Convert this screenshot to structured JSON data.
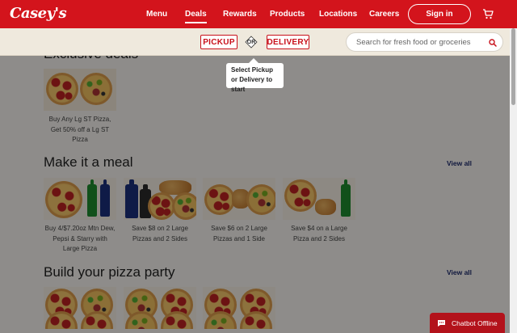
{
  "brand": {
    "logo": "Casey's",
    "color": "#d3141c"
  },
  "nav": {
    "items": [
      {
        "label": "Menu",
        "active": false
      },
      {
        "label": "Deals",
        "active": true
      },
      {
        "label": "Rewards",
        "active": false
      },
      {
        "label": "Products",
        "active": false
      },
      {
        "label": "Locations",
        "active": false
      },
      {
        "label": "Careers",
        "active": false
      }
    ],
    "signin_label": "Sign in",
    "cart_icon": "cart-icon"
  },
  "order_mode": {
    "pickup_label": "PICKUP",
    "or_label": "OR",
    "delivery_label": "DELIVERY"
  },
  "search": {
    "placeholder": "Search for fresh food or groceries",
    "icon": "search-icon"
  },
  "tooltip": {
    "text": "Select Pickup or Delivery to start"
  },
  "sections": [
    {
      "title": "Exclusive deals",
      "view_all": "",
      "cards": [
        {
          "label": "Buy Any Lg ST Pizza, Get 50% off a Lg ST Pizza"
        }
      ]
    },
    {
      "title": "Make it a meal",
      "view_all": "View all",
      "cards": [
        {
          "label": "Buy 4/$7.20oz Mtn Dew, Pepsi & Starry with Large Pizza"
        },
        {
          "label": "Save $8 on 2 Large Pizzas and 2 Sides"
        },
        {
          "label": "Save $6 on 2 Large Pizzas and 1 Side"
        },
        {
          "label": "Save $4 on a Large Pizza and 2 Sides"
        }
      ]
    },
    {
      "title": "Build your pizza party",
      "view_all": "View all",
      "cards": [
        {},
        {},
        {}
      ]
    }
  ],
  "chatbot": {
    "label": "Chatbot Offline",
    "icon": "chat-icon"
  }
}
